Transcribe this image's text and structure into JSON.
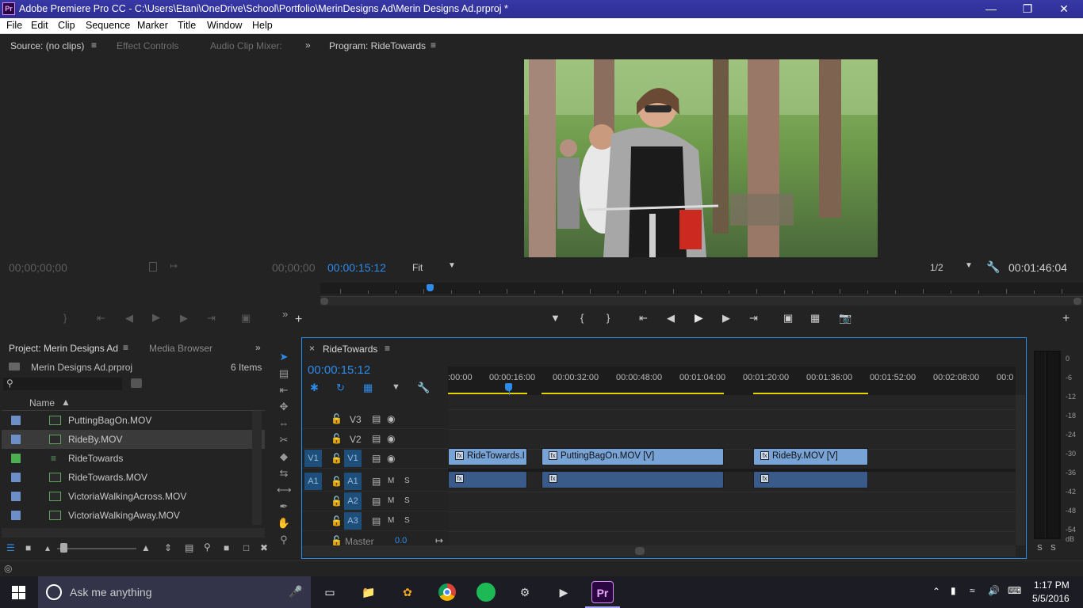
{
  "window": {
    "title": "Adobe Premiere Pro CC - C:\\Users\\Etani\\OneDrive\\School\\Portfolio\\MerinDesigns Ad\\Merin Designs Ad.prproj *",
    "app_icon": "Pr"
  },
  "menu": [
    "File",
    "Edit",
    "Clip",
    "Sequence",
    "Marker",
    "Title",
    "Window",
    "Help"
  ],
  "source_panel": {
    "tabs": [
      "Source: (no clips)",
      "Effect Controls",
      "Audio Clip Mixer: R"
    ],
    "timecode_in": "00;00;00;00",
    "timecode_out": "00;00;00"
  },
  "program_panel": {
    "title": "Program: RideTowards",
    "timecode": "00:00:15:12",
    "fit": "Fit",
    "resolution": "1/2",
    "duration": "00:01:46:04"
  },
  "project_panel": {
    "tabs": [
      "Project: Merin Designs Ad",
      "Media Browser"
    ],
    "project_file": "Merin Designs Ad.prproj",
    "item_count": "6 Items",
    "column_name": "Name",
    "items": [
      {
        "name": "PuttingBagOn.MOV",
        "color": "#6c8fc7",
        "type": "clip"
      },
      {
        "name": "RideBy.MOV",
        "color": "#6c8fc7",
        "type": "clip"
      },
      {
        "name": "RideTowards",
        "color": "#4caf50",
        "type": "sequence"
      },
      {
        "name": "RideTowards.MOV",
        "color": "#6c8fc7",
        "type": "clip"
      },
      {
        "name": "VictoriaWalkingAcross.MOV",
        "color": "#6c8fc7",
        "type": "clip"
      },
      {
        "name": "VictoriaWalkingAway.MOV",
        "color": "#6c8fc7",
        "type": "clip"
      }
    ]
  },
  "timeline": {
    "sequence_tab": "RideTowards",
    "timecode": "00:00:15:12",
    "ruler": [
      ":00:00",
      "00:00:16:00",
      "00:00:32:00",
      "00:00:48:00",
      "00:01:04:00",
      "00:01:20:00",
      "00:01:36:00",
      "00:01:52:00",
      "00:02:08:00",
      "00:0"
    ],
    "video_tracks": [
      "V3",
      "V2",
      "V1"
    ],
    "audio_tracks": [
      "A1",
      "A2",
      "A3"
    ],
    "source_v": "V1",
    "source_a": "A1",
    "master_label": "Master",
    "master_value": "0.0",
    "clips": [
      {
        "name": "RideTowards.MOV [V]",
        "label": "RideTowards.I"
      },
      {
        "name": "PuttingBagOn.MOV [V]",
        "label": "PuttingBagOn.MOV [V]"
      },
      {
        "name": "RideBy.MOV [V]",
        "label": "RideBy.MOV [V]"
      }
    ],
    "mute_label": "M",
    "solo_label": "S"
  },
  "audio_meter": {
    "scale": [
      "0",
      "-6",
      "-12",
      "-18",
      "-24",
      "-30",
      "-36",
      "-42",
      "-48",
      "-54",
      "dB"
    ],
    "solo": [
      "S",
      "S"
    ]
  },
  "taskbar": {
    "search_placeholder": "Ask me anything",
    "time": "1:17 PM",
    "date": "5/5/2016"
  }
}
